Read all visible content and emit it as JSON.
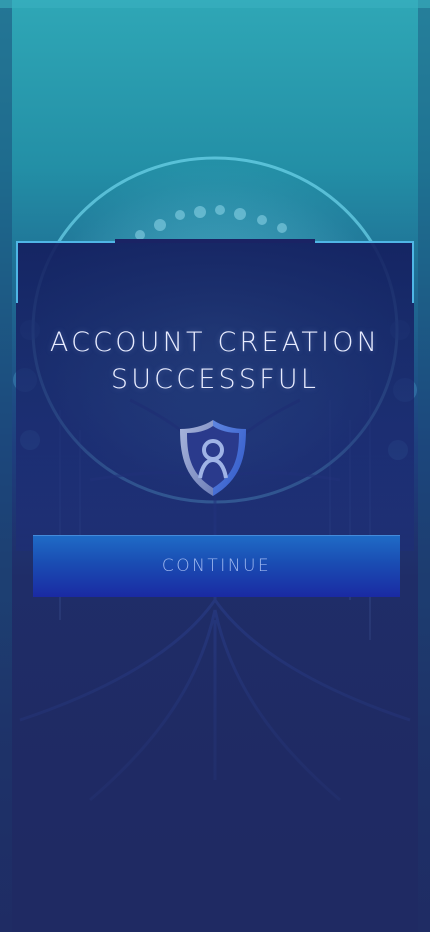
{
  "screen": {
    "title": "Account Creation Successful",
    "continue_label": "Continue"
  },
  "icons": {
    "shield": "shield-person-icon"
  },
  "colors": {
    "background": "#1f2a63",
    "accent": "#4fb6e6",
    "button_top": "#1f6cc7",
    "button_bottom": "#1a2aa3",
    "title_text": "#e8ecff",
    "button_text": "#9fb8f0"
  }
}
